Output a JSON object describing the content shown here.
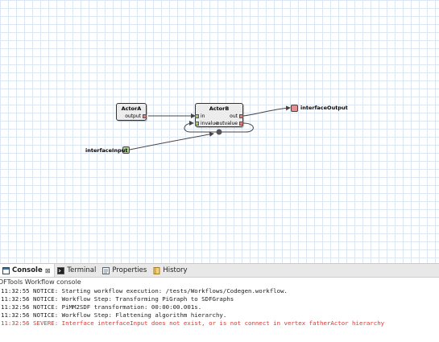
{
  "diagram": {
    "actor_a": {
      "title": "ActorA",
      "ports": {
        "out1": "output"
      }
    },
    "actor_b": {
      "title": "ActorB",
      "ports": {
        "in1": "in",
        "in2": "invalue",
        "out1": "out",
        "out2": "outvalue"
      }
    },
    "interface_output": {
      "label": "interfaceOutput"
    },
    "interface_input": {
      "label": "interfaceInput"
    },
    "colors": {
      "input_port": "#9bd36b",
      "output_port": "#e07e7e",
      "edge": "#444444"
    }
  },
  "console": {
    "tabs": [
      {
        "label": "Console",
        "icon": "console-icon"
      },
      {
        "label": "Terminal",
        "icon": "terminal-icon"
      },
      {
        "label": "Properties",
        "icon": "properties-icon"
      },
      {
        "label": "History",
        "icon": "history-icon"
      }
    ],
    "title": "DFTools Workflow console",
    "lines": [
      "11:32:55 NOTICE: Starting workflow execution: /tests/Workflows/Codegen.workflow.",
      "11:32:56 NOTICE: Workflow Step: Transforming PiGraph to SDFGraphs",
      "11:32:56 NOTICE: PiMM2SDF transformation: 00:00:00.001s.",
      "11:32:56 NOTICE: Workflow Step: Flattening algorithm hierarchy.",
      "11:32:56 SEVERE: Interface interfaceInput does not exist, or is not connect in vertex fatherActor hierarchy"
    ],
    "error_color": "#e0342e"
  }
}
